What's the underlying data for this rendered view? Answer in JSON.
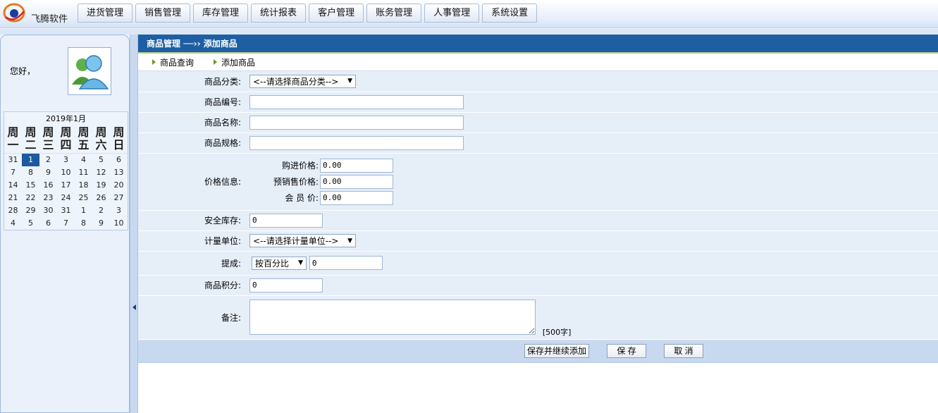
{
  "app": {
    "brand": "飞腾软件"
  },
  "nav": {
    "tabs": [
      "进货管理",
      "销售管理",
      "库存管理",
      "统计报表",
      "客户管理",
      "账务管理",
      "人事管理",
      "系统设置"
    ]
  },
  "sidebar": {
    "greeting": "您好，",
    "calendar": {
      "title": "2019年1月",
      "weekdays": [
        "周一",
        "周二",
        "周三",
        "周四",
        "周五",
        "周六",
        "周日"
      ],
      "days": [
        "31",
        "1",
        "2",
        "3",
        "4",
        "5",
        "6",
        "7",
        "8",
        "9",
        "10",
        "11",
        "12",
        "13",
        "14",
        "15",
        "16",
        "17",
        "18",
        "19",
        "20",
        "21",
        "22",
        "23",
        "24",
        "25",
        "26",
        "27",
        "28",
        "29",
        "30",
        "31",
        "1",
        "2",
        "3",
        "4",
        "5",
        "6",
        "7",
        "8",
        "9",
        "10"
      ],
      "selected_index": 1
    }
  },
  "main": {
    "breadcrumb": "商品管理 ──›› 添加商品",
    "subtabs": [
      "商品查询",
      "添加商品"
    ],
    "form": {
      "category_label": "商品分类:",
      "category_value": "<--请选择商品分类-->",
      "code_label": "商品编号:",
      "code_value": "",
      "name_label": "商品名称:",
      "name_value": "",
      "spec_label": "商品规格:",
      "spec_value": "",
      "price_label": "价格信息:",
      "purchase_label": "购进价格:",
      "purchase_value": "0.00",
      "presale_label": "预销售价格:",
      "presale_value": "0.00",
      "member_label": "会 员 价:",
      "member_value": "0.00",
      "stock_label": "安全库存:",
      "stock_value": "0",
      "unit_label": "计量单位:",
      "unit_value": "<--请选择计量单位-->",
      "commission_label": "提成:",
      "commission_type": "按百分比",
      "commission_value": "0",
      "points_label": "商品积分:",
      "points_value": "0",
      "remark_label": "备注:",
      "remark_value": "",
      "remark_hint": "[500字]"
    },
    "buttons": {
      "save_continue": "保存并继续添加",
      "save": "保  存",
      "cancel": "取  消"
    }
  }
}
